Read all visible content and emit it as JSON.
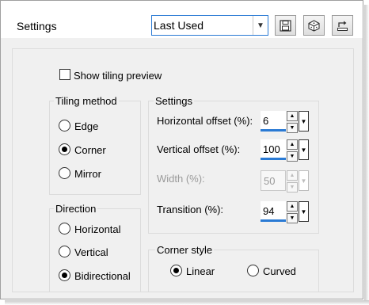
{
  "header": {
    "title": "Settings",
    "preset": {
      "value": "Last Used"
    },
    "buttons": {
      "save": "save-icon",
      "random": "dice-icon",
      "reset": "reset-icon"
    }
  },
  "preview": {
    "label": "Show tiling preview",
    "checked": false
  },
  "tiling_method": {
    "title": "Tiling method",
    "options": [
      {
        "label": "Edge",
        "selected": false
      },
      {
        "label": "Corner",
        "selected": true
      },
      {
        "label": "Mirror",
        "selected": false
      }
    ]
  },
  "direction": {
    "title": "Direction",
    "options": [
      {
        "label": "Horizontal",
        "selected": false
      },
      {
        "label": "Vertical",
        "selected": false
      },
      {
        "label": "Bidirectional",
        "selected": true
      }
    ]
  },
  "settings": {
    "title": "Settings",
    "fields": [
      {
        "label": "Horizontal offset (%):",
        "value": "6",
        "enabled": true
      },
      {
        "label": "Vertical offset (%):",
        "value": "100",
        "enabled": true
      },
      {
        "label": "Width (%):",
        "value": "50",
        "enabled": false
      },
      {
        "label": "Transition (%):",
        "value": "94",
        "enabled": true
      }
    ]
  },
  "corner_style": {
    "title": "Corner style",
    "options": [
      {
        "label": "Linear",
        "selected": true
      },
      {
        "label": "Curved",
        "selected": false
      }
    ]
  },
  "colors": {
    "accent": "#2a7ad4",
    "dialog_bg": "#f0f0f0",
    "disabled_text": "#9a9a9a"
  }
}
